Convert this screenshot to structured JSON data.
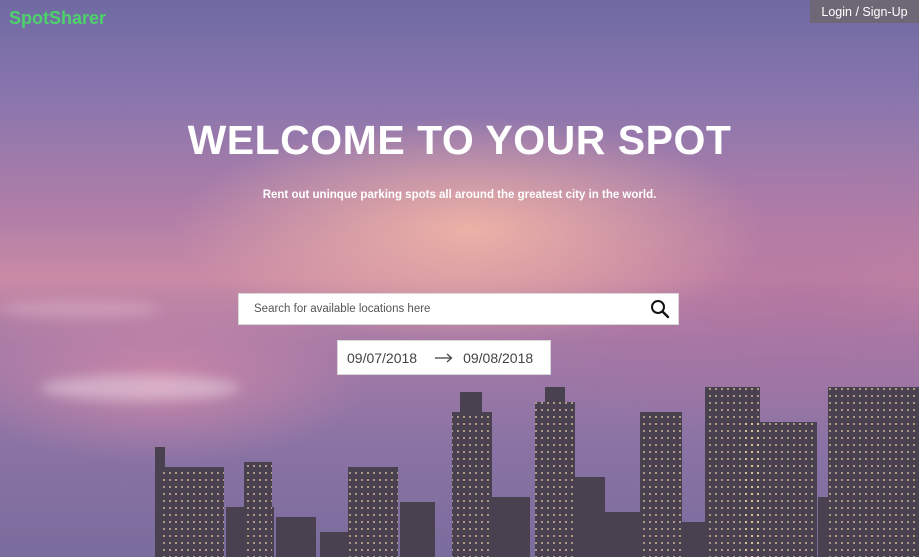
{
  "header": {
    "brand": "SpotSharer",
    "login_label": "Login / Sign-Up"
  },
  "hero": {
    "title": "WELCOME TO YOUR SPOT",
    "subtitle": "Rent out uninque parking spots all around the greatest city in the world."
  },
  "search": {
    "placeholder": "Search for available locations here",
    "icon": "search-icon"
  },
  "dates": {
    "start": "09/07/2018",
    "end": "09/08/2018",
    "separator_icon": "arrow-right-icon"
  },
  "colors": {
    "brand": "#4cd36a",
    "login_bg": "#6e6876"
  }
}
